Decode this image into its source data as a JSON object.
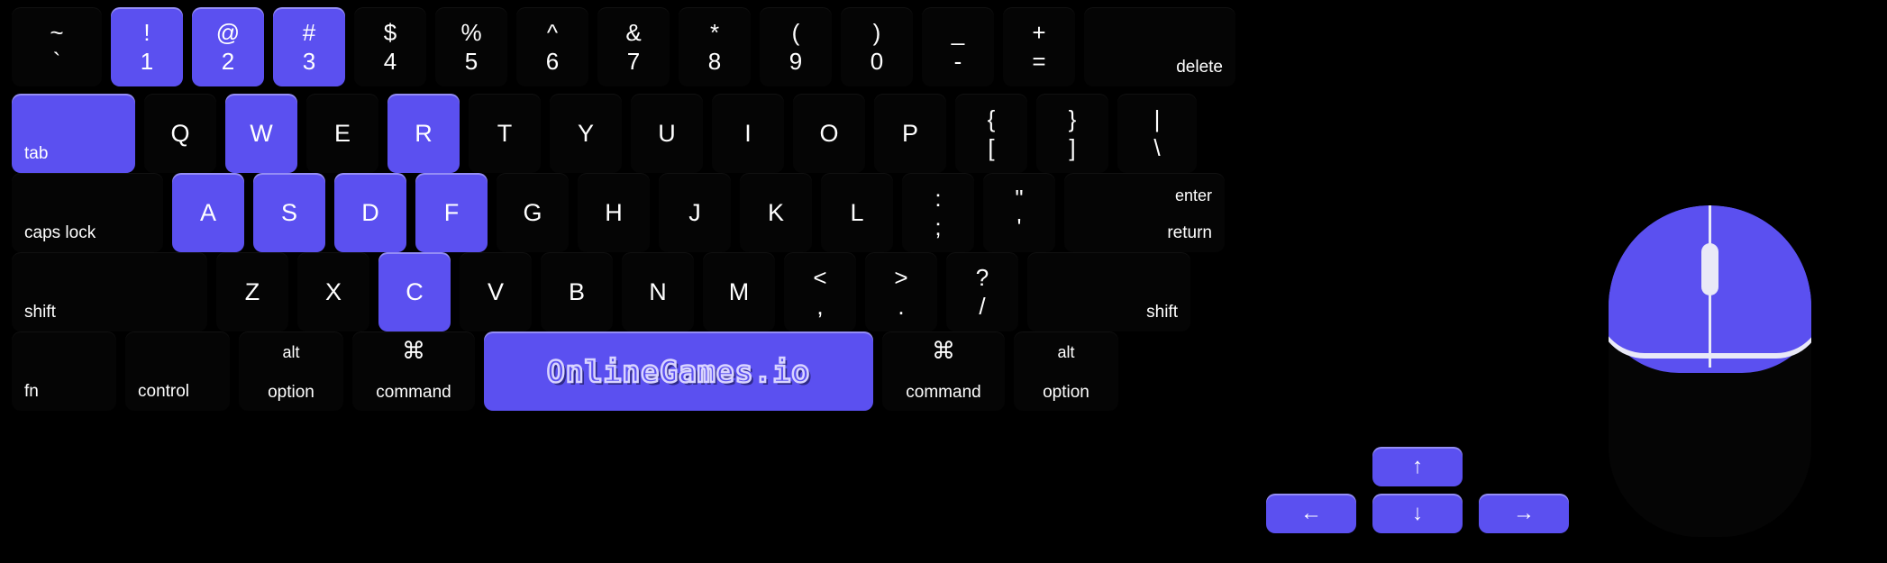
{
  "app": {
    "title": "OnlineGames.io virtual keyboard controls",
    "accent_color": "#5b50f0",
    "key_color": "#050505",
    "text_color": "#ffffff",
    "background_color": "#000000"
  },
  "spacebar": {
    "logo_text": "OnlineGames.io"
  },
  "rows": {
    "number_row": [
      {
        "name": "backtick",
        "top": "~",
        "bottom": "`",
        "active": false
      },
      {
        "name": "1",
        "top": "!",
        "bottom": "1",
        "active": true
      },
      {
        "name": "2",
        "top": "@",
        "bottom": "2",
        "active": true
      },
      {
        "name": "3",
        "top": "#",
        "bottom": "3",
        "active": true
      },
      {
        "name": "4",
        "top": "$",
        "bottom": "4",
        "active": false
      },
      {
        "name": "5",
        "top": "%",
        "bottom": "5",
        "active": false
      },
      {
        "name": "6",
        "top": "^",
        "bottom": "6",
        "active": false
      },
      {
        "name": "7",
        "top": "&",
        "bottom": "7",
        "active": false
      },
      {
        "name": "8",
        "top": "*",
        "bottom": "8",
        "active": false
      },
      {
        "name": "9",
        "top": "(",
        "bottom": "9",
        "active": false
      },
      {
        "name": "0",
        "top": ")",
        "bottom": "0",
        "active": false
      },
      {
        "name": "minus",
        "top": "_",
        "bottom": "-",
        "active": false
      },
      {
        "name": "equals",
        "top": "+",
        "bottom": "=",
        "active": false
      },
      {
        "name": "delete",
        "label": "delete",
        "active": false
      }
    ],
    "top_row": [
      {
        "name": "tab",
        "label": "tab",
        "active": true
      },
      {
        "name": "Q",
        "glyph": "Q",
        "active": false
      },
      {
        "name": "W",
        "glyph": "W",
        "active": true
      },
      {
        "name": "E",
        "glyph": "E",
        "active": false
      },
      {
        "name": "R",
        "glyph": "R",
        "active": true
      },
      {
        "name": "T",
        "glyph": "T",
        "active": false
      },
      {
        "name": "Y",
        "glyph": "Y",
        "active": false
      },
      {
        "name": "U",
        "glyph": "U",
        "active": false
      },
      {
        "name": "I",
        "glyph": "I",
        "active": false
      },
      {
        "name": "O",
        "glyph": "O",
        "active": false
      },
      {
        "name": "P",
        "glyph": "P",
        "active": false
      },
      {
        "name": "bracket-left",
        "top": "{",
        "bottom": "[",
        "active": false
      },
      {
        "name": "bracket-right",
        "top": "}",
        "bottom": "]",
        "active": false
      },
      {
        "name": "backslash",
        "top": "|",
        "bottom": "\\",
        "active": false
      }
    ],
    "home_row": [
      {
        "name": "caps-lock",
        "label": "caps lock",
        "active": false
      },
      {
        "name": "A",
        "glyph": "A",
        "active": true
      },
      {
        "name": "S",
        "glyph": "S",
        "active": true
      },
      {
        "name": "D",
        "glyph": "D",
        "active": true
      },
      {
        "name": "F",
        "glyph": "F",
        "active": true
      },
      {
        "name": "G",
        "glyph": "G",
        "active": false
      },
      {
        "name": "H",
        "glyph": "H",
        "active": false
      },
      {
        "name": "J",
        "glyph": "J",
        "active": false
      },
      {
        "name": "K",
        "glyph": "K",
        "active": false
      },
      {
        "name": "L",
        "glyph": "L",
        "active": false
      },
      {
        "name": "semicolon",
        "top": ":",
        "bottom": ";",
        "active": false
      },
      {
        "name": "quote",
        "top": "\"",
        "bottom": "'",
        "active": false
      },
      {
        "name": "return",
        "label_top": "enter",
        "label": "return",
        "active": false
      }
    ],
    "bottom_letter_row": [
      {
        "name": "shift-left",
        "label": "shift",
        "active": false
      },
      {
        "name": "Z",
        "glyph": "Z",
        "active": false
      },
      {
        "name": "X",
        "glyph": "X",
        "active": false
      },
      {
        "name": "C",
        "glyph": "C",
        "active": true
      },
      {
        "name": "V",
        "glyph": "V",
        "active": false
      },
      {
        "name": "B",
        "glyph": "B",
        "active": false
      },
      {
        "name": "N",
        "glyph": "N",
        "active": false
      },
      {
        "name": "M",
        "glyph": "M",
        "active": false
      },
      {
        "name": "comma",
        "top": "<",
        "bottom": ",",
        "active": false
      },
      {
        "name": "period",
        "top": ">",
        "bottom": ".",
        "active": false
      },
      {
        "name": "slash",
        "top": "?",
        "bottom": "/",
        "active": false
      },
      {
        "name": "shift-right",
        "label": "shift",
        "active": false
      }
    ],
    "modifier_row": [
      {
        "name": "fn",
        "label": "fn",
        "active": false
      },
      {
        "name": "control",
        "label": "control",
        "active": false
      },
      {
        "name": "option-left",
        "top": "alt",
        "label": "option",
        "active": false
      },
      {
        "name": "command-left",
        "top": "⌘",
        "label": "command",
        "active": false
      },
      {
        "name": "space",
        "logo": "OnlineGames.io",
        "active": true
      },
      {
        "name": "command-right",
        "top": "⌘",
        "label": "command",
        "active": false
      },
      {
        "name": "option-right",
        "top": "alt",
        "label": "option",
        "active": false
      }
    ],
    "arrow_keys": [
      {
        "name": "arrow-left",
        "glyph": "←",
        "active": true
      },
      {
        "name": "arrow-up",
        "glyph": "↑",
        "active": true
      },
      {
        "name": "arrow-down",
        "glyph": "↓",
        "active": true
      },
      {
        "name": "arrow-right",
        "glyph": "→",
        "active": true
      }
    ]
  },
  "mouse": {
    "name": "computer-mouse",
    "left_button_color": "#5b50f0",
    "body_color": "#050505",
    "wheel_color": "#e9e9f7"
  }
}
